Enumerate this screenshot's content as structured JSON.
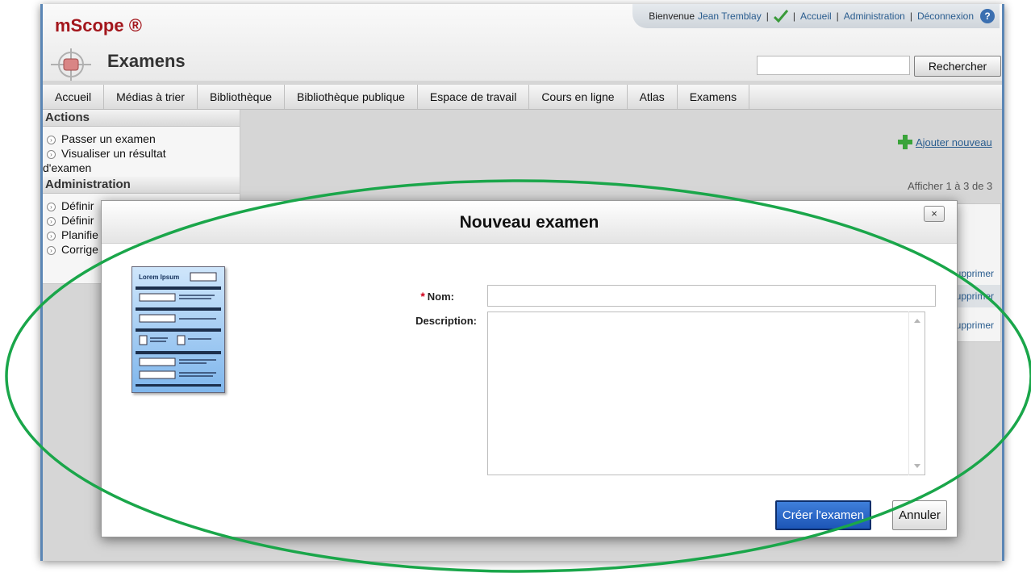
{
  "header": {
    "logo": "mScope ®",
    "app_title": "Examens",
    "welcome_prefix": "Bienvenue",
    "user_name": "Jean Tremblay",
    "links": [
      "Accueil",
      "Administration",
      "Déconnexion"
    ],
    "help_symbol": "?",
    "search_button": "Rechercher",
    "search_value": ""
  },
  "nav": {
    "tabs": [
      "Accueil",
      "Médias à trier",
      "Bibliothèque",
      "Bibliothèque publique",
      "Espace de travail",
      "Cours en ligne",
      "Atlas",
      "Examens"
    ]
  },
  "sidebar": {
    "actions_title": "Actions",
    "actions": [
      "Passer un examen",
      "Visualiser un résultat"
    ],
    "actions_wrap": "d'examen",
    "admin_title": "Administration",
    "admin_items": [
      "Définir",
      "Définir",
      "Planifie",
      "Corrige"
    ]
  },
  "main": {
    "add_new": "Ajouter nouveau",
    "showing": "Afficher 1 à 3 de 3",
    "row_actions": [
      "Supprimer",
      "Supprimer",
      "Supprimer"
    ]
  },
  "dialog": {
    "title": "Nouveau examen",
    "close_symbol": "×",
    "illustration_title": "Lorem Ipsum",
    "required_mark": "*",
    "name_label": "Nom:",
    "description_label": "Description:",
    "name_value": "",
    "description_value": "",
    "create_button": "Créer l'examen",
    "cancel_button": "Annuler"
  },
  "colors": {
    "brand": "#a3161c",
    "link": "#2a5d8f",
    "primary_button": "#1c55b6",
    "annotation_ellipse": "#1aa64a"
  }
}
